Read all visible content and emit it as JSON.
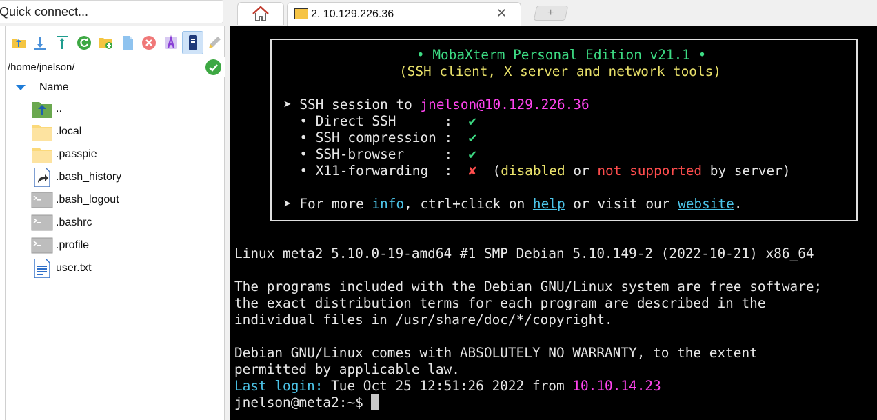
{
  "quick_connect": {
    "placeholder": "Quick connect..."
  },
  "tabs": {
    "home_icon": "home-icon",
    "session_title": "2. 10.129.226.36",
    "close_label": "✕",
    "new_tab_label": "+"
  },
  "sftp": {
    "path": "/home/jnelson/",
    "column_header": "Name",
    "toolbar": [
      {
        "name": "parent-folder-icon"
      },
      {
        "name": "download-icon"
      },
      {
        "name": "upload-icon"
      },
      {
        "name": "refresh-icon"
      },
      {
        "name": "new-folder-icon"
      },
      {
        "name": "new-file-icon"
      },
      {
        "name": "delete-icon"
      },
      {
        "name": "rename-icon"
      },
      {
        "name": "follow-terminal-icon"
      },
      {
        "name": "edit-icon"
      }
    ],
    "files": [
      {
        "name": "..",
        "icon": "parent-folder-icon"
      },
      {
        "name": ".local",
        "icon": "folder-icon"
      },
      {
        "name": ".passpie",
        "icon": "folder-icon"
      },
      {
        "name": ".bash_history",
        "icon": "shortcut-file-icon"
      },
      {
        "name": ".bash_logout",
        "icon": "shell-script-icon"
      },
      {
        "name": ".bashrc",
        "icon": "shell-script-icon"
      },
      {
        "name": ".profile",
        "icon": "shell-script-icon"
      },
      {
        "name": "user.txt",
        "icon": "text-file-icon"
      }
    ]
  },
  "terminal": {
    "banner": {
      "title": "• MobaXterm Personal Edition v21.1 •",
      "subtitle": "(SSH client, X server and network tools)",
      "session_prefix": "➤ SSH session to ",
      "session_target": "jnelson@10.129.226.36",
      "features": [
        {
          "label": "  • Direct SSH      :  ",
          "mark": "✔"
        },
        {
          "label": "  • SSH compression :  ",
          "mark": "✔"
        },
        {
          "label": "  • SSH-browser     :  ",
          "mark": "✔"
        },
        {
          "label": "  • X11-forwarding  :  ",
          "mark": "✘"
        }
      ],
      "x11_note_open": "  (",
      "x11_disabled": "disabled",
      "x11_or": " or ",
      "x11_not_supported": "not supported",
      "x11_note_close": " by server)",
      "more_1": "➤ For more ",
      "more_info": "info",
      "more_2": ", ctrl+click on ",
      "more_help": "help",
      "more_3": " or visit our ",
      "more_website": "website",
      "more_4": "."
    },
    "lines": {
      "uname": "Linux meta2 5.10.0-19-amd64 #1 SMP Debian 5.10.149-2 (2022-10-21) x86_64",
      "motd1": "The programs included with the Debian GNU/Linux system are free software;",
      "motd2": "the exact distribution terms for each program are described in the",
      "motd3": "individual files in /usr/share/doc/*/copyright.",
      "warranty1": "Debian GNU/Linux comes with ABSOLUTELY NO WARRANTY, to the extent",
      "warranty2": "permitted by applicable law.",
      "last_login_label": "Last login:",
      "last_login_value": " Tue Oct 25 12:51:26 2022 from ",
      "last_login_ip": "10.10.14.23",
      "prompt": "jnelson@meta2:~$ "
    }
  }
}
